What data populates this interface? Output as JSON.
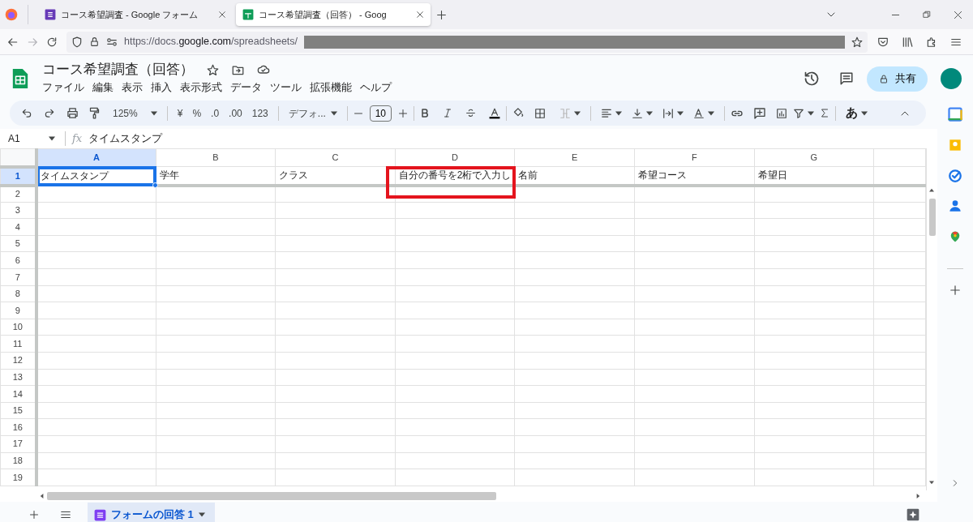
{
  "browser": {
    "tabs": [
      {
        "title": "コース希望調査 - Google フォーム",
        "kind": "forms",
        "selected": false
      },
      {
        "title": "コース希望調査（回答） - Goog",
        "kind": "sheets",
        "selected": true
      }
    ],
    "url": {
      "scheme": "https://docs.",
      "domain": "google.com",
      "path": "/spreadsheets/"
    }
  },
  "document": {
    "title": "コース希望調査（回答）",
    "menu": [
      "ファイル",
      "編集",
      "表示",
      "挿入",
      "表示形式",
      "データ",
      "ツール",
      "拡張機能",
      "ヘルプ"
    ],
    "share": "共有"
  },
  "toolbar": {
    "zoom": "125%",
    "currency": "¥",
    "percent": "%",
    "decrease_decimal": ".0",
    "increase_decimal": ".00",
    "number_format": "123",
    "font": "デフォ...",
    "font_size": "10",
    "input_method": "あ"
  },
  "formula_bar": {
    "cell": "A1",
    "fx": "fx",
    "value": "タイムスタンプ"
  },
  "sheet": {
    "columns": [
      {
        "label": "A",
        "selected": true
      },
      {
        "label": "B",
        "selected": false
      },
      {
        "label": "C",
        "selected": false
      },
      {
        "label": "D",
        "selected": false
      },
      {
        "label": "E",
        "selected": false
      },
      {
        "label": "F",
        "selected": false
      },
      {
        "label": "G",
        "selected": false
      }
    ],
    "rows": [
      {
        "number": "1",
        "selected": true,
        "cells": [
          {
            "text": "タイムスタンプ",
            "selected": true,
            "highlighted": false
          },
          {
            "text": "学年",
            "selected": false,
            "highlighted": false
          },
          {
            "text": "クラス",
            "selected": false,
            "highlighted": false
          },
          {
            "text": "自分の番号を2桁で入力し",
            "selected": false,
            "highlighted": true
          },
          {
            "text": "名前",
            "selected": false,
            "highlighted": false
          },
          {
            "text": "希望コース",
            "selected": false,
            "highlighted": false
          },
          {
            "text": "希望日",
            "selected": false,
            "highlighted": false
          }
        ]
      },
      {
        "number": "2",
        "selected": false
      },
      {
        "number": "3",
        "selected": false
      },
      {
        "number": "4",
        "selected": false
      },
      {
        "number": "5",
        "selected": false
      },
      {
        "number": "6",
        "selected": false
      },
      {
        "number": "7",
        "selected": false
      },
      {
        "number": "8",
        "selected": false
      },
      {
        "number": "9",
        "selected": false
      },
      {
        "number": "10",
        "selected": false
      },
      {
        "number": "11",
        "selected": false
      },
      {
        "number": "12",
        "selected": false
      },
      {
        "number": "13",
        "selected": false
      },
      {
        "number": "14",
        "selected": false
      },
      {
        "number": "15",
        "selected": false
      },
      {
        "number": "16",
        "selected": false
      },
      {
        "number": "17",
        "selected": false
      },
      {
        "number": "18",
        "selected": false
      },
      {
        "number": "19",
        "selected": false
      }
    ]
  },
  "sheet_tabs": [
    {
      "label": "フォームの回答 1",
      "selected": true
    }
  ]
}
